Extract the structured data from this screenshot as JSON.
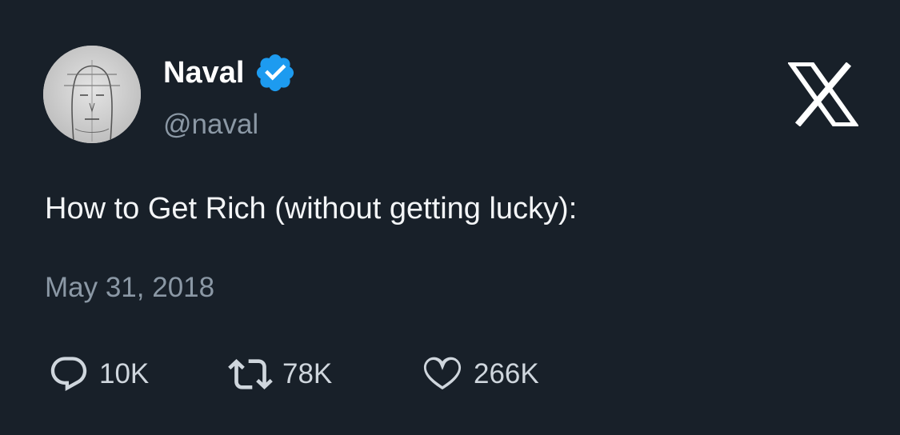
{
  "author": {
    "name": "Naval",
    "handle": "@naval",
    "verified_color": "#1d9bf0"
  },
  "tweet": {
    "text": "How to Get Rich (without getting lucky):",
    "date": "May 31, 2018"
  },
  "actions": {
    "replies": "10K",
    "retweets": "78K",
    "likes": "266K"
  },
  "icons": {
    "avatar": "avatar",
    "verified": "verified-badge-icon",
    "brand": "x-logo-icon",
    "reply": "reply-icon",
    "retweet": "retweet-icon",
    "like": "heart-icon"
  },
  "colors": {
    "background": "#182029",
    "primary_text": "#ffffff",
    "secondary_text": "#8b98a5"
  }
}
